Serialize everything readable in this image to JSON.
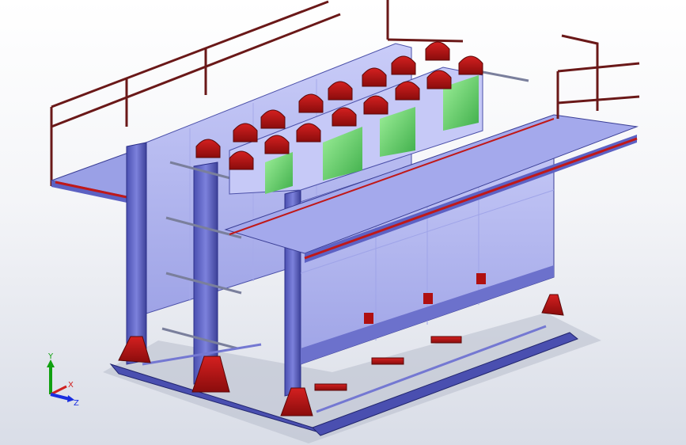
{
  "view": {
    "background_top": "#ffffff",
    "background_bottom": "#d9dde7",
    "colors": {
      "frame": "#6f74d0",
      "frame_dark": "#2b2f88",
      "panel": "#b8bcf2",
      "panel_light": "#d3d6fb",
      "bracket": "#b01010",
      "bracket_dark": "#6a0a0a",
      "module_green": "#5fd06a",
      "rail": "#7a1a1a"
    }
  },
  "triad": {
    "x_label": "X",
    "y_label": "Y",
    "z_label": "Z",
    "x_color": "#d02020",
    "y_color": "#10a010",
    "z_color": "#1a2ee0"
  }
}
